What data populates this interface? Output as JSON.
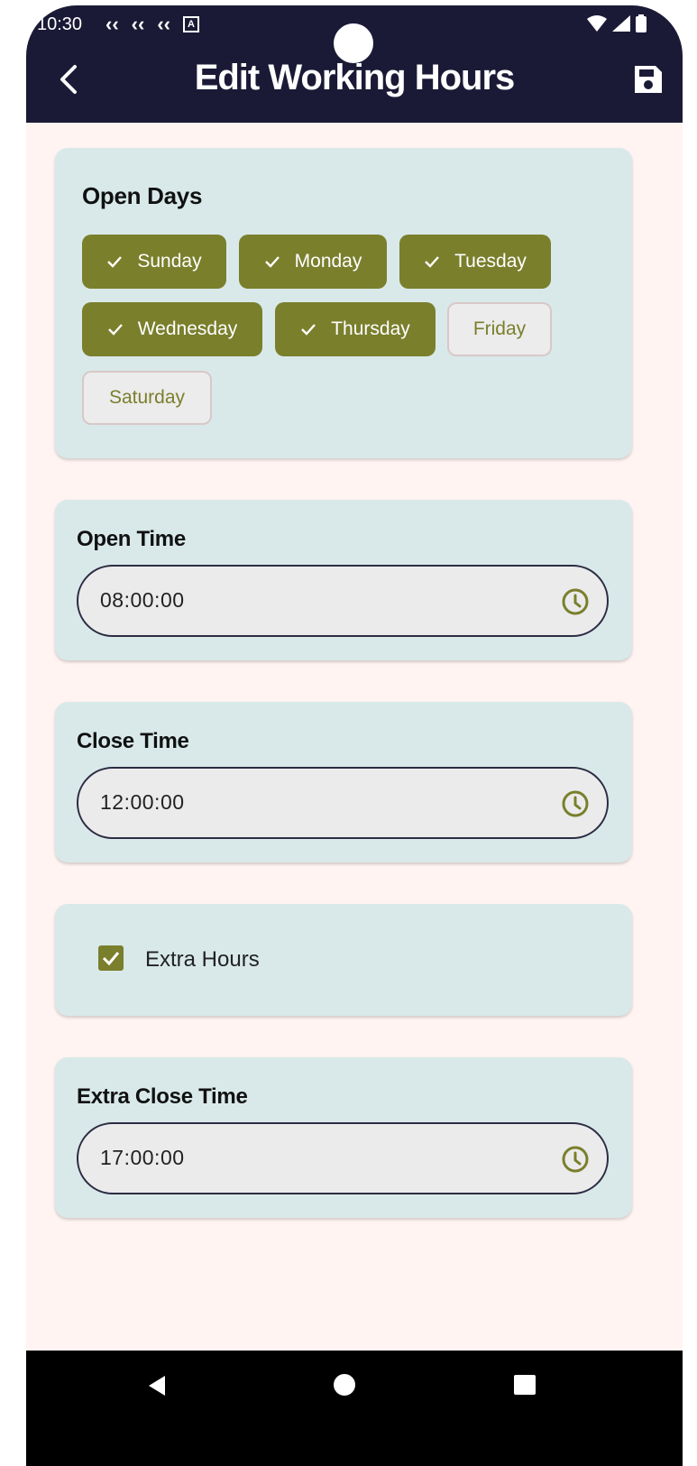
{
  "status_bar": {
    "time": "10:30",
    "notification_icons": [
      "flutter-icon",
      "flutter-icon",
      "flutter-icon",
      "a-icon"
    ]
  },
  "header": {
    "title": "Edit Working Hours",
    "back_icon": "chevron-left-icon",
    "save_icon": "floppy-disk-icon"
  },
  "open_days": {
    "title": "Open Days",
    "days": [
      {
        "label": "Sunday",
        "selected": true
      },
      {
        "label": "Monday",
        "selected": true
      },
      {
        "label": "Tuesday",
        "selected": true
      },
      {
        "label": "Wednesday",
        "selected": true
      },
      {
        "label": "Thursday",
        "selected": true
      },
      {
        "label": "Friday",
        "selected": false
      },
      {
        "label": "Saturday",
        "selected": false
      }
    ]
  },
  "open_time": {
    "label": "Open Time",
    "value": "08:00:00"
  },
  "close_time": {
    "label": "Close Time",
    "value": "12:00:00"
  },
  "extra_hours": {
    "label": "Extra Hours",
    "checked": true
  },
  "extra_close_time": {
    "label": "Extra Close Time",
    "value": "17:00:00"
  },
  "colors": {
    "header_bg": "#1b1a36",
    "accent": "#7a7f2c",
    "card_bg": "#d9e9e9",
    "page_bg": "#fff4f2"
  }
}
